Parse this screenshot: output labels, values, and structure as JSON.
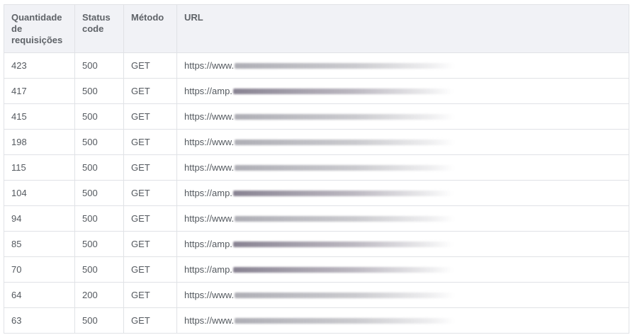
{
  "table": {
    "headers": {
      "count": "Quantidade de requisições",
      "status": "Status code",
      "method": "Método",
      "url": "URL"
    },
    "rows": [
      {
        "count": "423",
        "status": "500",
        "method": "GET",
        "url": "https://www."
      },
      {
        "count": "417",
        "status": "500",
        "method": "GET",
        "url": "https://amp."
      },
      {
        "count": "415",
        "status": "500",
        "method": "GET",
        "url": "https://www."
      },
      {
        "count": "198",
        "status": "500",
        "method": "GET",
        "url": "https://www."
      },
      {
        "count": "115",
        "status": "500",
        "method": "GET",
        "url": "https://www."
      },
      {
        "count": "104",
        "status": "500",
        "method": "GET",
        "url": "https://amp."
      },
      {
        "count": "94",
        "status": "500",
        "method": "GET",
        "url": "https://www."
      },
      {
        "count": "85",
        "status": "500",
        "method": "GET",
        "url": "https://amp."
      },
      {
        "count": "70",
        "status": "500",
        "method": "GET",
        "url": "https://amp."
      },
      {
        "count": "64",
        "status": "200",
        "method": "GET",
        "url": "https://www."
      },
      {
        "count": "63",
        "status": "500",
        "method": "GET",
        "url": "https://www."
      }
    ]
  }
}
